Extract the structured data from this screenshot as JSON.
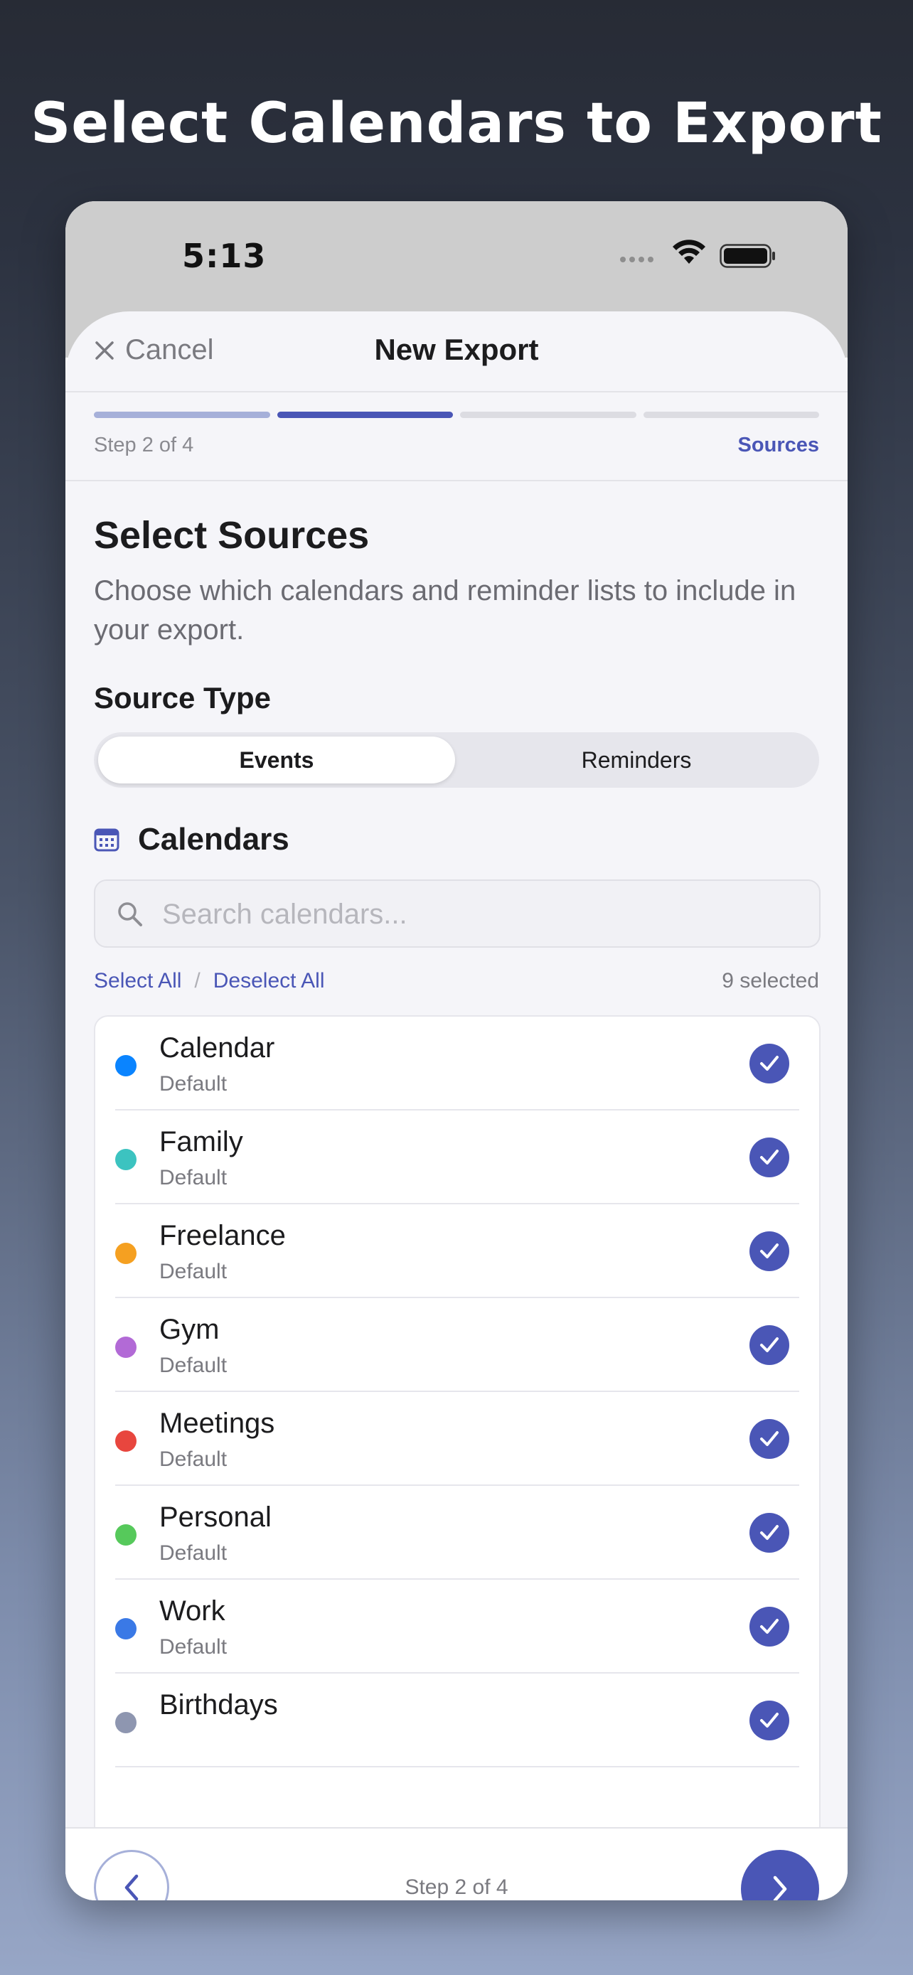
{
  "headline": "Select Calendars to Export",
  "status_bar": {
    "time": "5:13"
  },
  "nav": {
    "cancel_label": "Cancel",
    "title": "New Export"
  },
  "progress": {
    "current_step": 2,
    "total_steps": 4,
    "step_label": "Step 2 of 4",
    "step_name": "Sources"
  },
  "section": {
    "title": "Select Sources",
    "description": "Choose which calendars and reminder lists to include in your export."
  },
  "source_type": {
    "label": "Source Type",
    "options": [
      "Events",
      "Reminders"
    ],
    "selected": "Events"
  },
  "calendars": {
    "header": "Calendars",
    "search_placeholder": "Search calendars...",
    "search_value": "",
    "select_all": "Select All",
    "separator": "/",
    "deselect_all": "Deselect All",
    "selected_count": "9 selected",
    "items": [
      {
        "name": "Calendar",
        "source": "Default",
        "color": "#0a84ff",
        "checked": true
      },
      {
        "name": "Family",
        "source": "Default",
        "color": "#3cc3c0",
        "checked": true
      },
      {
        "name": "Freelance",
        "source": "Default",
        "color": "#f5a021",
        "checked": true
      },
      {
        "name": "Gym",
        "source": "Default",
        "color": "#b26ad6",
        "checked": true
      },
      {
        "name": "Meetings",
        "source": "Default",
        "color": "#e8463e",
        "checked": true
      },
      {
        "name": "Personal",
        "source": "Default",
        "color": "#56c95b",
        "checked": true
      },
      {
        "name": "Work",
        "source": "Default",
        "color": "#3a79e6",
        "checked": true
      },
      {
        "name": "Birthdays",
        "source": "",
        "color": "#8e96b0",
        "checked": true
      }
    ]
  },
  "bottom": {
    "step_label": "Step 2 of 4"
  },
  "colors": {
    "accent": "#4a56b6",
    "accent_light": "#a6b0d9"
  },
  "icons": {
    "close": "close-icon",
    "calendar": "calendar-icon",
    "search": "search-icon",
    "check": "checkmark-icon",
    "back": "chevron-left-icon",
    "next": "chevron-right-icon",
    "wifi": "wifi-icon",
    "battery": "battery-icon",
    "signal": "signal-icon"
  }
}
